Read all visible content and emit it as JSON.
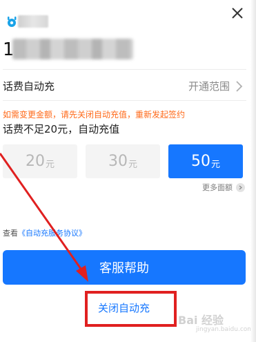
{
  "header": {
    "phone_prefix": "1",
    "close_icon": "close-icon"
  },
  "autopay": {
    "row_title": "话费自动充",
    "row_link": "开通范围",
    "warning": "如需变更金额，请先关闭自动充值，重新发起签约",
    "condition": "话费不足20元，自动充值",
    "amounts": [
      {
        "value": "20",
        "unit": "元",
        "selected": false
      },
      {
        "value": "30",
        "unit": "元",
        "selected": false
      },
      {
        "value": "50",
        "unit": "元",
        "selected": true
      }
    ],
    "more_amounts": "更多面额",
    "agreement_prefix": "查看",
    "agreement_link": "《自动充服务协议》"
  },
  "actions": {
    "help_button": "客服帮助",
    "turn_off_link": "关闭自动充"
  },
  "watermark": {
    "text": "Bai 经验",
    "sub": "jingyan.baidu.com"
  },
  "colors": {
    "accent": "#1677ff",
    "warning": "#ff6a1a",
    "annotation": "#e02020"
  }
}
